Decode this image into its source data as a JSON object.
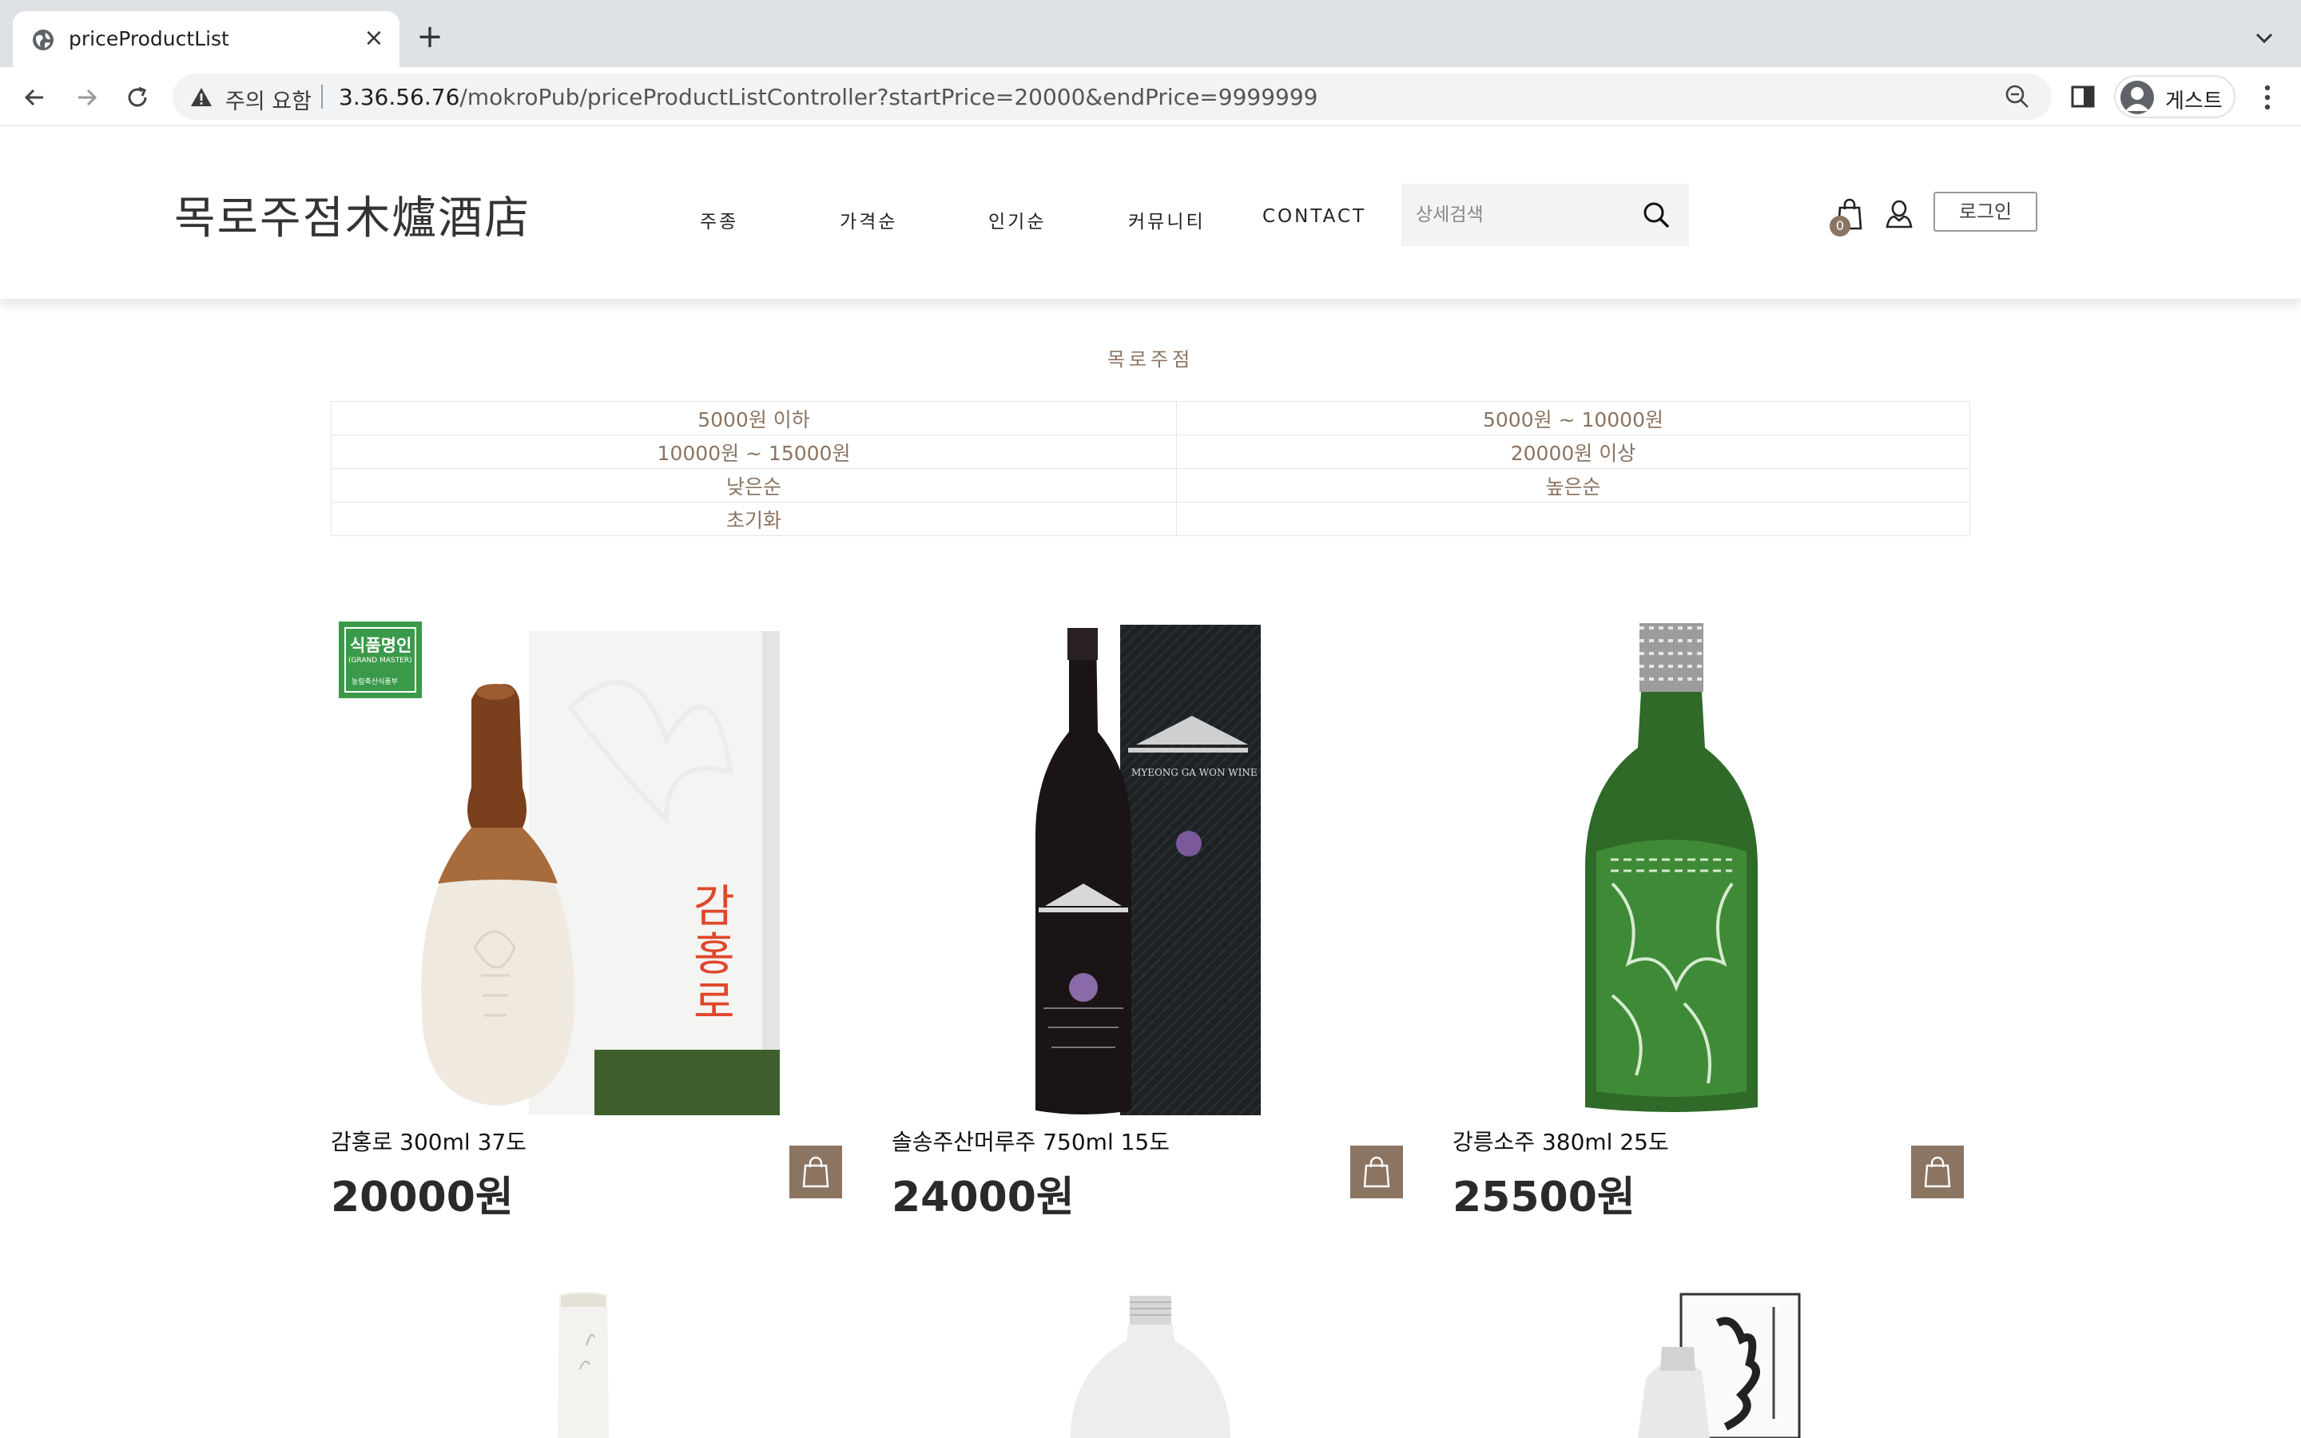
{
  "browser": {
    "tab_title": "priceProductList",
    "tab_close": "×",
    "new_tab": "+",
    "security_warning": "주의 요함",
    "url_host": "3.36.56.76",
    "url_path": "/mokroPub/priceProductListController?startPrice=20000&endPrice=9999999",
    "profile_label": "게스트"
  },
  "header": {
    "logo": "목로주점木爐酒店",
    "nav": [
      "주종",
      "가격순",
      "인기순",
      "커뮤니티",
      "CONTACT"
    ],
    "search_placeholder": "상세검색",
    "cart_count": "0",
    "login_label": "로그인"
  },
  "main": {
    "section_title": "목로주점",
    "price_filters": [
      [
        "5000원 이하",
        "5000원 ~ 10000원"
      ],
      [
        "10000원 ~ 15000원",
        "20000원 이상"
      ],
      [
        "낮은순",
        "높은순"
      ],
      [
        "초기화",
        ""
      ]
    ],
    "products": [
      {
        "name": "감홍로 300ml 37도",
        "price": "20000원",
        "label_text": "감홍로",
        "badge": "식품명인",
        "badge_sub": "(GRAND MASTER)",
        "badge_org": "농림축산식품부"
      },
      {
        "name": "솔송주산머루주 750ml 15도",
        "price": "24000원",
        "label_text": "MYEONG GA WON WINE"
      },
      {
        "name": "강릉소주 380ml 25도",
        "price": "25500원"
      }
    ]
  },
  "colors": {
    "accent": "#8b7462",
    "tabbar": "#dee1e6",
    "omnibox": "#f1f3f4"
  },
  "icons": [
    "globe-icon",
    "close-icon",
    "plus-icon",
    "chevron-down-icon",
    "back-arrow-icon",
    "forward-arrow-icon",
    "reload-icon",
    "warning-icon",
    "zoom-icon",
    "side-panel-icon",
    "profile-icon",
    "more-vert-icon",
    "search-icon",
    "shopping-bag-icon",
    "user-icon"
  ]
}
